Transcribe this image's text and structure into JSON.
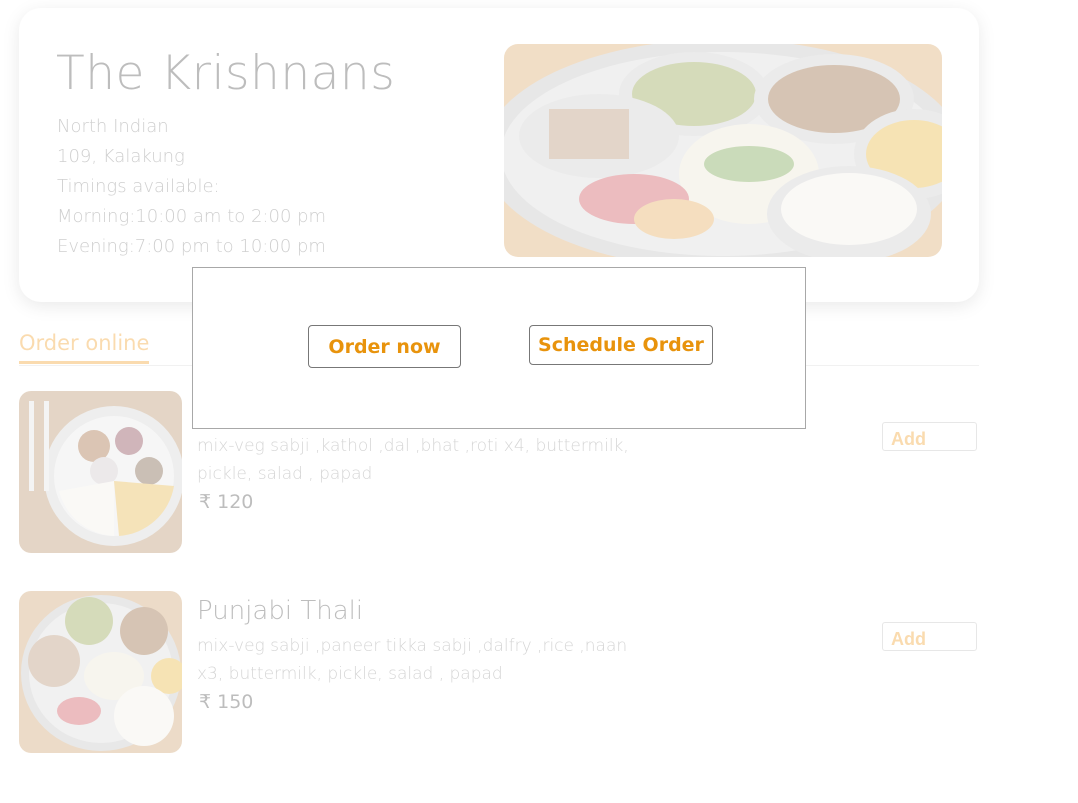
{
  "restaurant": {
    "name": "The Krishnans",
    "cuisine": "North Indian",
    "address": "109, Kalakung",
    "timings_label": "Timings available:",
    "morning": "Morning:10:00 am to 2:00 pm",
    "evening": "Evening:7:00 pm to 10:00 pm"
  },
  "tabs": {
    "order_online": "Order online"
  },
  "menu": {
    "items": [
      {
        "name": "",
        "description": "mix-veg sabji ,kathol ,dal ,bhat ,roti x4, buttermilk, pickle, salad , papad",
        "price": "₹ 120",
        "add_label": "Add"
      },
      {
        "name": "Punjabi Thali",
        "description": "mix-veg sabji ,paneer tikka sabji ,dalfry ,rice ,naan x3, buttermilk, pickle, salad , papad",
        "price": "₹ 150",
        "add_label": "Add"
      }
    ]
  },
  "modal": {
    "order_now_label": "Order now",
    "schedule_label": "Schedule Order"
  },
  "colors": {
    "accent": "#f29b1d",
    "modal_text": "#e8930c"
  }
}
